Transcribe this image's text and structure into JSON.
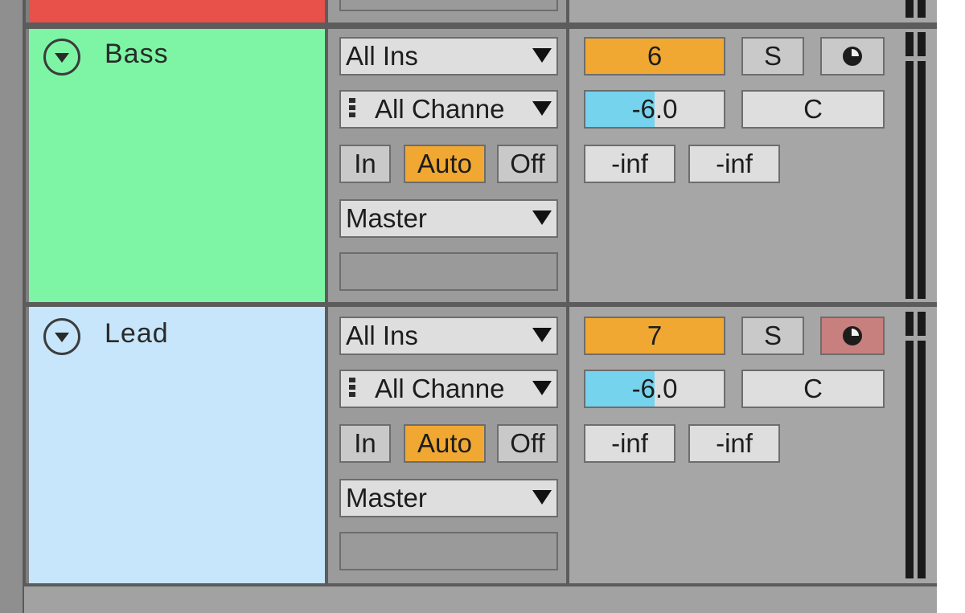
{
  "colors": {
    "top_track": "#e8504a",
    "bass_track": "#7df5a5",
    "lead_track": "#c7e6fb",
    "accent_orange": "#f0a832",
    "volume_fill": "#76d3ee",
    "solo_active_red": "#c8807e"
  },
  "tracks": [
    {
      "name": "Bass",
      "input_type": "All Ins",
      "input_channel": "All Channe",
      "monitor": {
        "in": "In",
        "auto": "Auto",
        "off": "Off",
        "active": "Auto"
      },
      "output": "Master",
      "track_number": "6",
      "solo_label": "S",
      "arm_icon": "record-arm-icon",
      "arm_active": false,
      "volume": "-6.0",
      "volume_fraction": 0.5,
      "pan": "C",
      "sends": [
        "-inf",
        "-inf"
      ]
    },
    {
      "name": "Lead",
      "input_type": "All Ins",
      "input_channel": "All Channe",
      "monitor": {
        "in": "In",
        "auto": "Auto",
        "off": "Off",
        "active": "Auto"
      },
      "output": "Master",
      "track_number": "7",
      "solo_label": "S",
      "arm_icon": "record-arm-icon",
      "arm_active": true,
      "volume": "-6.0",
      "volume_fraction": 0.5,
      "pan": "C",
      "sends": [
        "-inf",
        "-inf"
      ]
    }
  ]
}
